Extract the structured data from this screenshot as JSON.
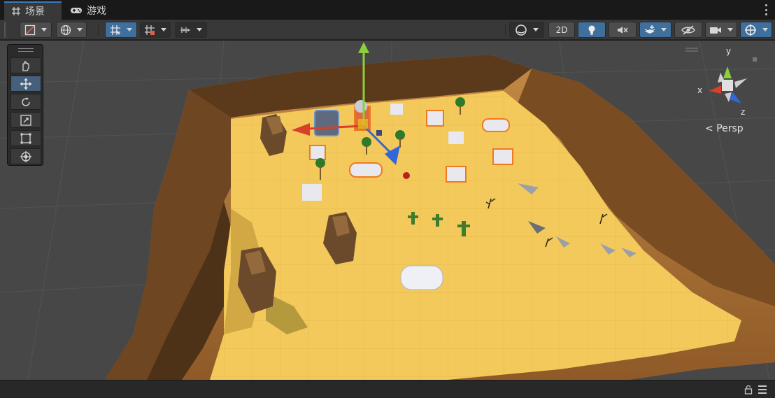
{
  "tabs": [
    {
      "label": "场景",
      "icon": "grid-icon",
      "active": true
    },
    {
      "label": "游戏",
      "icon": "gamepad-icon",
      "active": false
    }
  ],
  "toolbar": {
    "view_2d_label": "2D"
  },
  "gizmo": {
    "projection_label": "Persp",
    "axis_x": "x",
    "axis_y": "y",
    "axis_z": "z"
  },
  "colors": {
    "sand": "#f3c95b",
    "cliff": "#b07a3a",
    "cliff_dark": "#5a3a1c",
    "selection_outline": "#f07a1e",
    "axis_x": "#d8402a",
    "axis_y": "#8ccf3a",
    "axis_z": "#3366d8"
  }
}
